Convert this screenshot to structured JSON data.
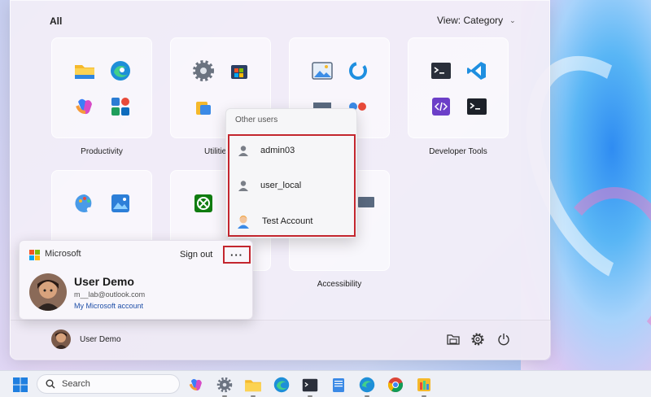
{
  "start_menu": {
    "all_label": "All",
    "view_label": "View: Category",
    "groups": [
      {
        "label": "Productivity"
      },
      {
        "label": "Utilities &"
      },
      {
        "label": ""
      },
      {
        "label": "Developer Tools"
      },
      {
        "label": ""
      },
      {
        "label": ""
      },
      {
        "label": "Accessibility"
      },
      {
        "label": ""
      }
    ]
  },
  "other_users": {
    "title": "Other users",
    "users": [
      {
        "name": "admin03",
        "icon": "person-icon"
      },
      {
        "name": "user_local",
        "icon": "person-icon"
      },
      {
        "name": "Test Account",
        "icon": "avatar-icon"
      }
    ]
  },
  "account": {
    "brand": "Microsoft",
    "sign_out": "Sign out",
    "more": "···",
    "name": "User Demo",
    "email": "m__lab@outlook.com",
    "link": "My Microsoft account"
  },
  "footer": {
    "user_name": "User Demo"
  },
  "taskbar": {
    "search_placeholder": "Search"
  },
  "colors": {
    "highlight": "#c3262e",
    "link": "#1f4fa8"
  }
}
